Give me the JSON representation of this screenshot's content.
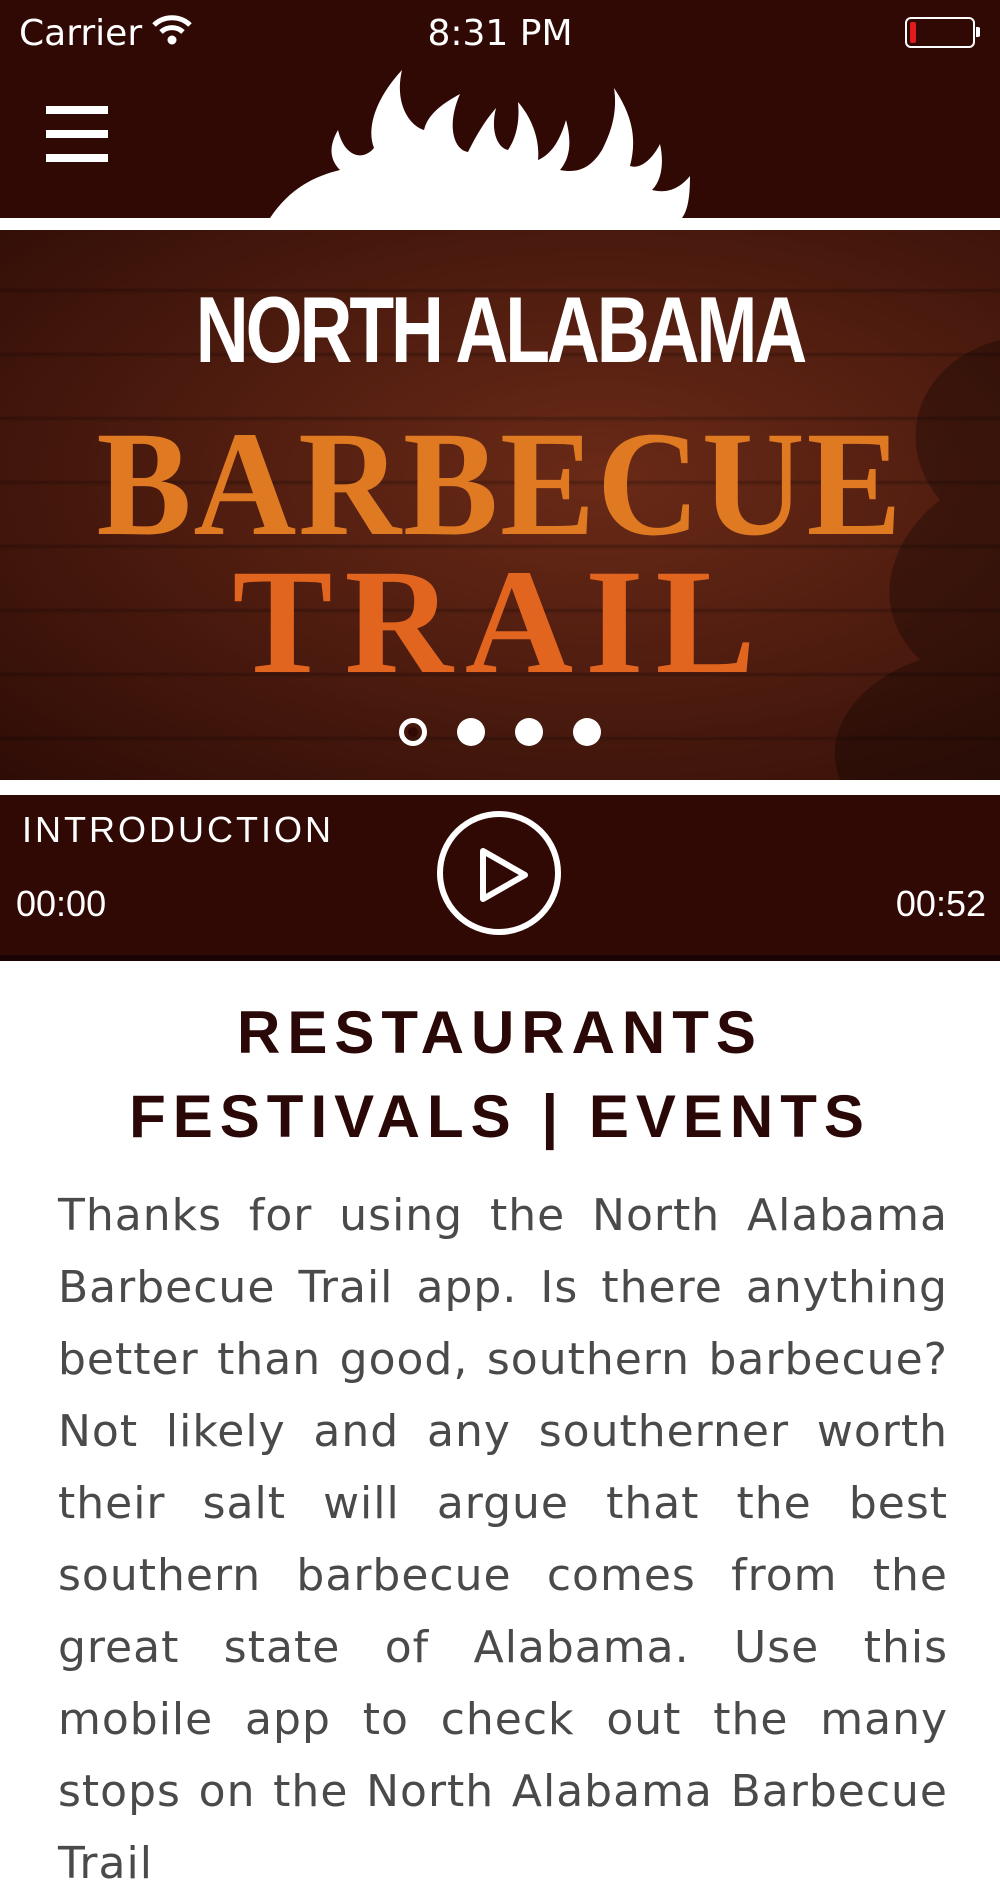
{
  "status_bar": {
    "carrier": "Carrier",
    "time": "8:31 PM",
    "battery_level": 0.1,
    "battery_color": "#e11b1b"
  },
  "header": {
    "menu_icon": "hamburger-menu-icon",
    "logo_icon": "flame-logo-icon",
    "background_color": "#300905"
  },
  "hero": {
    "line1": "NORTH ALABAMA",
    "line2": "BARBECUE",
    "line3": "TRAIL",
    "accent_color": "#e07a22",
    "carousel_pages": 4,
    "carousel_active_index": 0
  },
  "audio_player": {
    "title": "INTRODUCTION",
    "current_time": "00:00",
    "duration": "00:52",
    "play_icon": "play-icon"
  },
  "content": {
    "heading_line1": "RESTAURANTS",
    "heading_line2": "FESTIVALS | EVENTS",
    "heading_color": "#2b0808",
    "body": "Thanks for using the North Alabama Barbecue Trail app. Is there anything better than good, southern barbecue? Not likely and any southerner worth their salt will argue that the best southern barbecue comes from the great state of Alabama. Use this mobile app to check out the many stops on the North Alabama Barbecue Trail"
  }
}
